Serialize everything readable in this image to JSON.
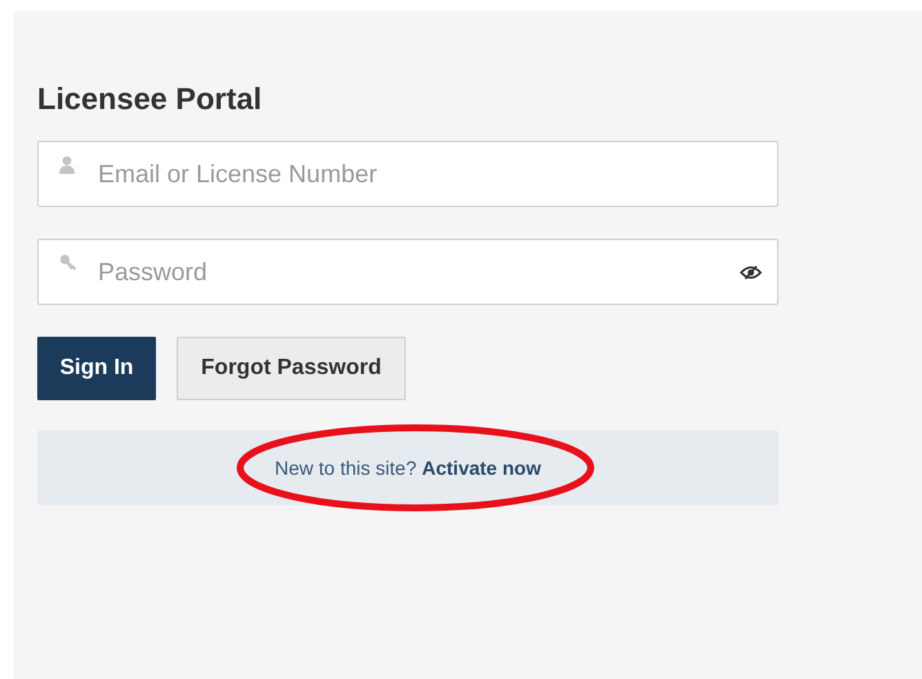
{
  "title": "Licensee Portal",
  "fields": [
    {
      "kind": "user",
      "placeholder": "Email or License Number",
      "reveal": false
    },
    {
      "kind": "key",
      "placeholder": "Password",
      "reveal": true
    }
  ],
  "buttons": [
    {
      "label": "Sign In",
      "kind": "primary"
    },
    {
      "label": "Forgot Password",
      "kind": "secondary"
    }
  ],
  "banner": {
    "text": "New to this site?",
    "link": "Activate now"
  },
  "annotation": {
    "kind": "ellipse",
    "color": "#e8101a"
  }
}
